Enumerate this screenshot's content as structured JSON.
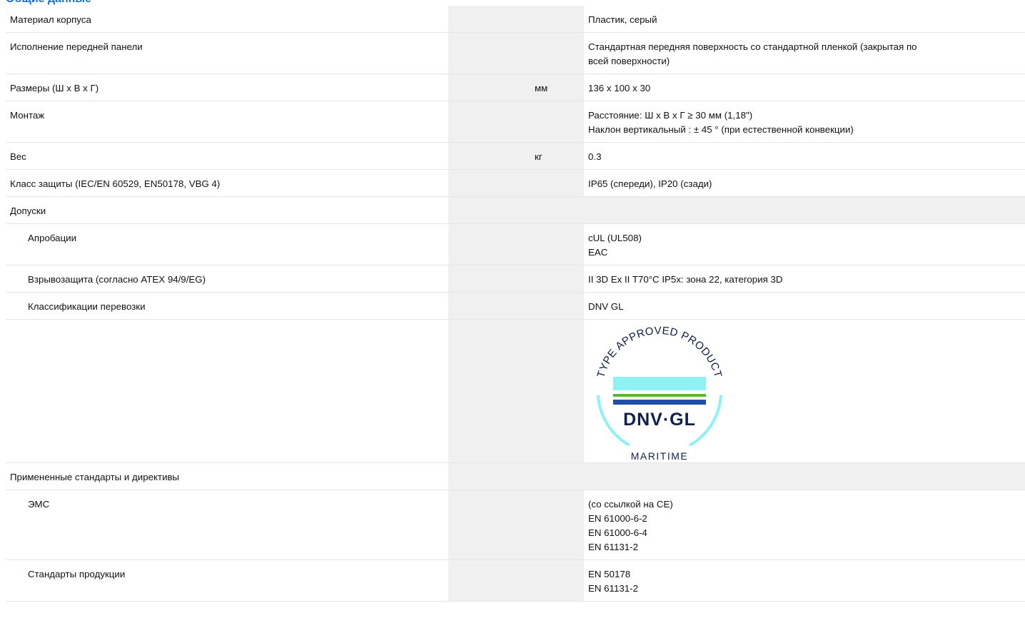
{
  "section_title": "Общие данные",
  "rows": [
    {
      "label": "Материал корпуса",
      "unit": "",
      "value": [
        "Пластик, серый"
      ]
    },
    {
      "label": "Исполнение передней панели",
      "unit": "",
      "value": [
        "Стандартная передняя поверхность со стандартной пленкой (закрытая по",
        "всей поверхности)"
      ]
    },
    {
      "label": "Размеры (Ш x В x Г)",
      "unit": "мм",
      "value": [
        "136 x 100 x 30"
      ]
    },
    {
      "label": "Монтаж",
      "unit": "",
      "value": [
        "Расстояние: Ш x В x Г ≥ 30 мм (1,18\")",
        "Наклон вертикальный : ± 45 ° (при естественной конвекции)"
      ]
    },
    {
      "label": "Вес",
      "unit": "кг",
      "value": [
        "0.3"
      ]
    },
    {
      "label": "Класс защиты (IEC/EN 60529, EN50178, VBG 4)",
      "unit": "",
      "value": [
        "IP65 (спереди), IP20 (сзади)"
      ]
    },
    {
      "label": "Допуски",
      "unit": "",
      "value": []
    },
    {
      "label": "Апробации",
      "unit": "",
      "value": [
        "cUL (UL508)",
        "EAC"
      ]
    },
    {
      "label": "Взрывозащита (согласно ATEX 94/9/EG)",
      "unit": "",
      "value": [
        "II 3D Ex II T70°C IP5x: зона 22, категория 3D"
      ]
    },
    {
      "label": "Классификации перевозки",
      "unit": "",
      "value": [
        "DNV GL"
      ]
    },
    {
      "label": "",
      "unit": "",
      "value": []
    },
    {
      "label": "Примененные стандарты и директивы",
      "unit": "",
      "value": []
    },
    {
      "label": "ЭМС",
      "unit": "",
      "value": [
        "(со ссылкой на CE)",
        "EN 61000-6-2",
        "EN 61000-6-4",
        "EN 61131-2"
      ]
    },
    {
      "label": "Стандарты продукции",
      "unit": "",
      "value": [
        "EN 50178",
        "EN 61131-2"
      ]
    }
  ],
  "logo": {
    "arc_text": "TYPE APPROVED PRODUCT",
    "brand": "DNV·GL",
    "bottom_text": "MARITIME",
    "colors": {
      "cyan": "#8ff1f4",
      "green": "#5ab933",
      "blue": "#1f50a6",
      "navy": "#0f204b"
    }
  }
}
